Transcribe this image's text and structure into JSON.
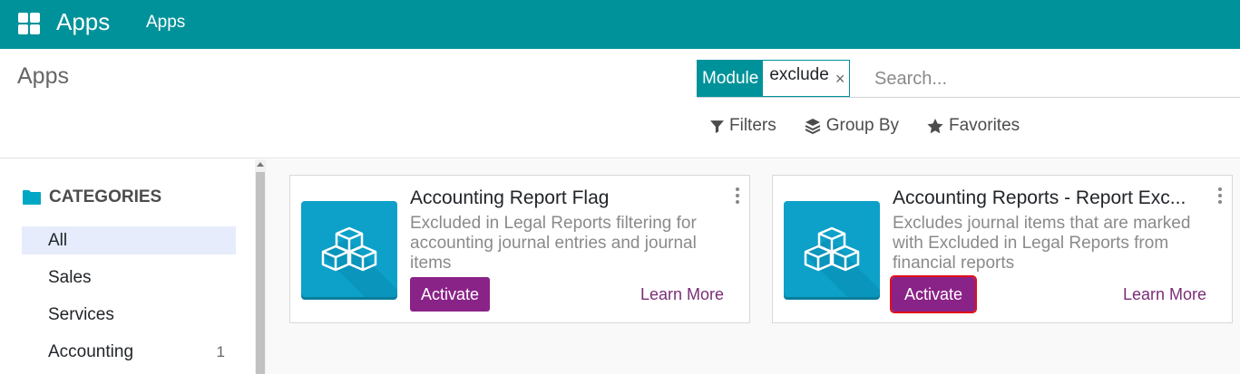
{
  "navbar": {
    "brand": "Apps",
    "menu_item": "Apps",
    "color": "#00929a"
  },
  "control_panel": {
    "title": "Apps",
    "search": {
      "facet_label": "Module",
      "facet_value": "exclude",
      "facet_remove": "×",
      "placeholder": "Search..."
    },
    "filters": {
      "filters_label": "Filters",
      "group_by_label": "Group By",
      "favorites_label": "Favorites"
    }
  },
  "sidebar": {
    "header": "CATEGORIES",
    "items": [
      {
        "label": "All",
        "count": "",
        "active": true
      },
      {
        "label": "Sales",
        "count": ""
      },
      {
        "label": "Services",
        "count": ""
      },
      {
        "label": "Accounting",
        "count": "1"
      }
    ]
  },
  "cards": [
    {
      "title": "Accounting Report Flag",
      "description": "Excluded in Legal Reports filtering for accounting journal entries and journal items",
      "action_label": "Activate",
      "link_label": "Learn More"
    },
    {
      "title": "Accounting Reports - Report Exc...",
      "description": "Excludes journal items that are marked with Excluded in Legal Reports from financial reports",
      "action_label": "Activate",
      "link_label": "Learn More",
      "highlighted": true
    }
  ],
  "colors": {
    "primary": "#00929a",
    "accent": "#8a2387",
    "icon_bg": "#0da1c9",
    "highlight": "#e0101a"
  }
}
